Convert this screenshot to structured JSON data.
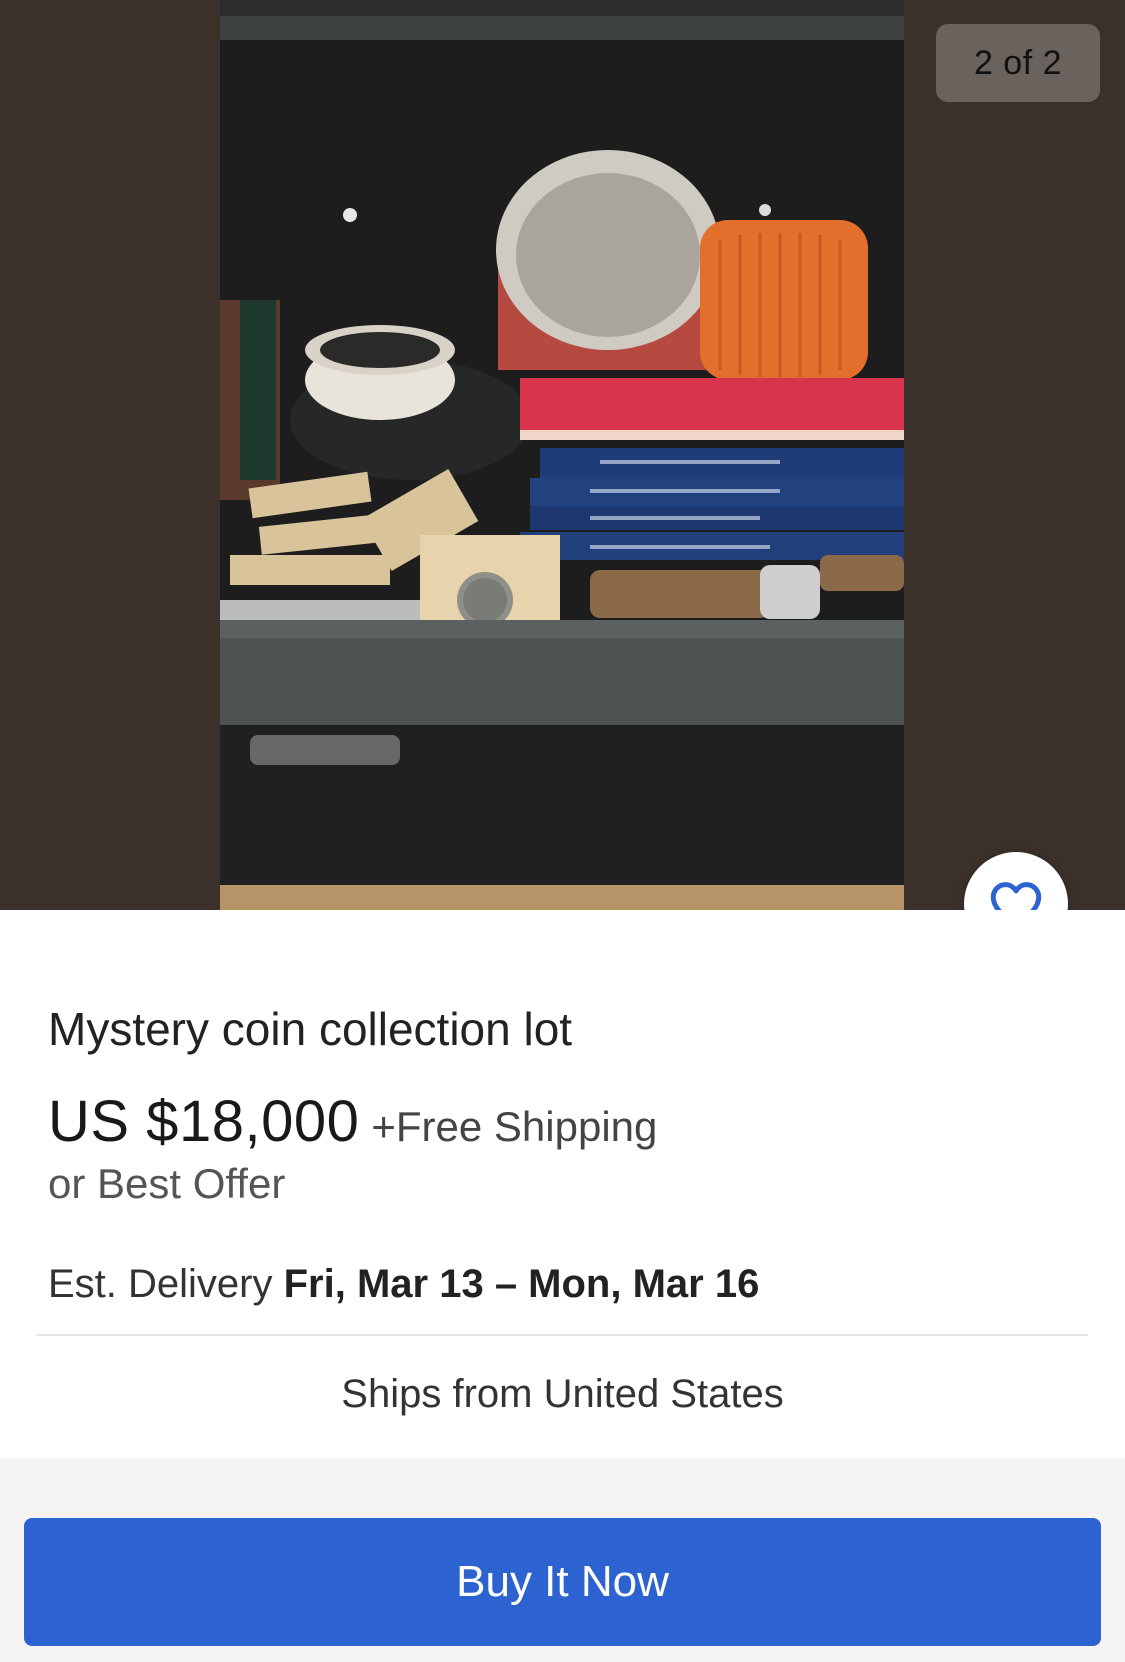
{
  "gallery": {
    "counter": "2 of 2",
    "image_alt": "Photo of coins in a safe"
  },
  "listing": {
    "title": "Mystery coin collection lot",
    "price": "US $18,000",
    "shipping": "+Free Shipping",
    "offer": "or Best Offer",
    "delivery_label": "Est. Delivery",
    "delivery_dates": "Fri, Mar 13 – Mon, Mar 16",
    "ships_from": "Ships from United States"
  },
  "actions": {
    "buy_now_label": "Buy It Now"
  },
  "icons": {
    "watch": "heart-icon"
  },
  "colors": {
    "accent": "#2c63d1",
    "hero_bg": "#3b302a"
  }
}
